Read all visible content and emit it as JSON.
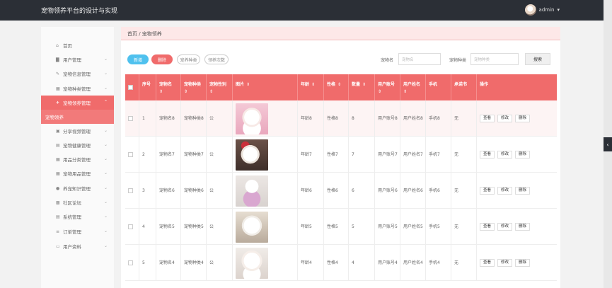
{
  "app_title": "宠物领养平台的设计与实现",
  "user_name": "admin",
  "user_caret": "▾",
  "sidebar": [
    {
      "label": "首页",
      "icon": "home-icon",
      "glyph": "⌂"
    },
    {
      "label": "用户管理",
      "icon": "user-icon",
      "glyph": "▇"
    },
    {
      "label": "宠物信息管理",
      "icon": "pet-icon",
      "glyph": "✎"
    },
    {
      "label": "宠物种类管理",
      "icon": "category-icon",
      "glyph": "▦"
    },
    {
      "label": "宠物领养管理",
      "icon": "adopt-icon",
      "glyph": "✈"
    },
    {
      "label": "宠物领养",
      "icon": "",
      "glyph": ""
    },
    {
      "label": "分享视频管理",
      "icon": "video-icon",
      "glyph": "▣"
    },
    {
      "label": "宠物健康管理",
      "icon": "health-icon",
      "glyph": "▤"
    },
    {
      "label": "用品分类管理",
      "icon": "grid-icon",
      "glyph": "▦"
    },
    {
      "label": "宠物用品管理",
      "icon": "grid-icon",
      "glyph": "▦"
    },
    {
      "label": "养宠知识管理",
      "icon": "location-icon",
      "glyph": "●"
    },
    {
      "label": "社区论坛",
      "icon": "forum-icon",
      "glyph": "▩"
    },
    {
      "label": "系统管理",
      "icon": "settings-icon",
      "glyph": "▤"
    },
    {
      "label": "订单管理",
      "icon": "order-icon",
      "glyph": "≡"
    },
    {
      "label": "用户资料",
      "icon": "profile-icon",
      "glyph": "▭"
    }
  ],
  "breadcrumb": "首页 / 宠物领养",
  "toolbar": {
    "add": "新增",
    "delete": "删除",
    "btn3": "宠养种类",
    "btn4": "领养次数"
  },
  "search": {
    "label1": "宠物名",
    "placeholder1": "宠物名",
    "label2": "宠物种类",
    "placeholder2": "宠物种类",
    "button": "搜索"
  },
  "columns": [
    "序号",
    "宠物名",
    "宠物种类",
    "宠物性别",
    "图片",
    "年龄",
    "性格",
    "数量",
    "用户账号",
    "用户姓名",
    "手机",
    "承诺书",
    "操作"
  ],
  "sort_glyph": "⇕",
  "rows": [
    {
      "index": "1",
      "name": "宠物名8",
      "type": "宠物种类8",
      "gender": "公",
      "age": "年龄8",
      "personality": "性格8",
      "count": "8",
      "account": "用户账号8",
      "username": "用户姓名8",
      "phone": "手机8",
      "promise": "无"
    },
    {
      "index": "2",
      "name": "宠物名7",
      "type": "宠物种类7",
      "gender": "公",
      "age": "年龄7",
      "personality": "性格7",
      "count": "7",
      "account": "用户账号7",
      "username": "用户姓名7",
      "phone": "手机7",
      "promise": "无"
    },
    {
      "index": "3",
      "name": "宠物名6",
      "type": "宠物种类6",
      "gender": "公",
      "age": "年龄6",
      "personality": "性格6",
      "count": "6",
      "account": "用户账号6",
      "username": "用户姓名6",
      "phone": "手机6",
      "promise": "无"
    },
    {
      "index": "4",
      "name": "宠物名5",
      "type": "宠物种类5",
      "gender": "公",
      "age": "年龄5",
      "personality": "性格5",
      "count": "5",
      "account": "用户账号5",
      "username": "用户姓名5",
      "phone": "手机5",
      "promise": "无"
    },
    {
      "index": "5",
      "name": "宠物名4",
      "type": "宠物种类4",
      "gender": "公",
      "age": "年龄4",
      "personality": "性格4",
      "count": "4",
      "account": "用户账号4",
      "username": "用户姓名4",
      "phone": "手机4",
      "promise": "无"
    }
  ],
  "row_actions": {
    "view": "查看",
    "edit": "修改",
    "delete": "删除"
  },
  "colors": {
    "accent": "#f06b6b",
    "add": "#4fc1ee",
    "topbar": "#2b2f36"
  }
}
